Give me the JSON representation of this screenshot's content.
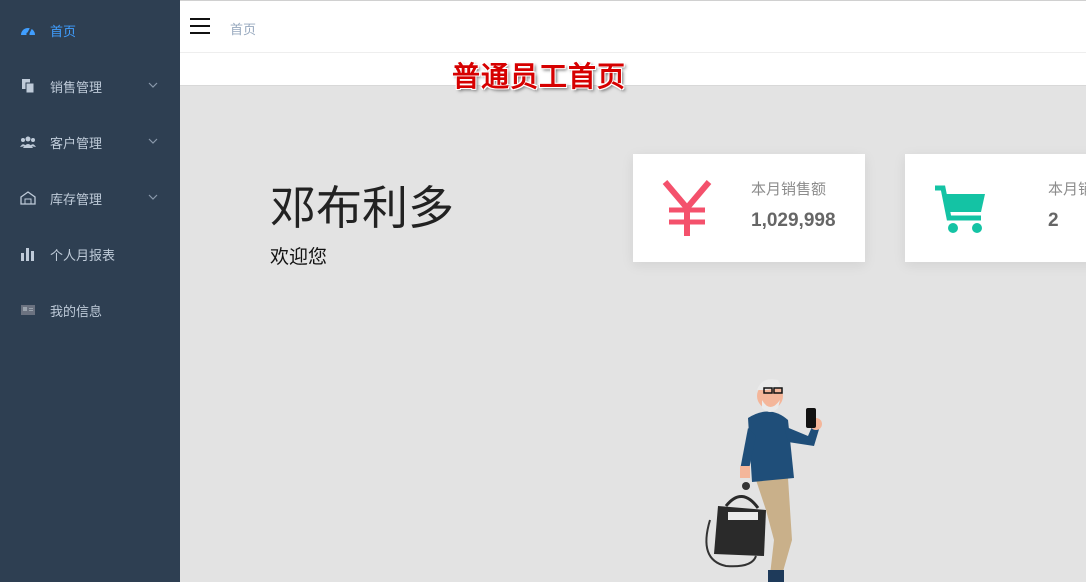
{
  "sidebar": {
    "items": [
      {
        "label": "首页",
        "icon": "dashboard-icon",
        "active": true
      },
      {
        "label": "销售管理",
        "icon": "documents-icon",
        "expandable": true
      },
      {
        "label": "客户管理",
        "icon": "customers-icon",
        "expandable": true
      },
      {
        "label": "库存管理",
        "icon": "warehouse-icon",
        "expandable": true
      },
      {
        "label": "个人月报表",
        "icon": "bar-chart-icon"
      },
      {
        "label": "我的信息",
        "icon": "id-card-icon"
      }
    ]
  },
  "header": {
    "breadcrumb": "首页"
  },
  "banner": {
    "title": "普通员工首页"
  },
  "main": {
    "user_name": "邓布利多",
    "welcome": "欢迎您"
  },
  "cards": [
    {
      "label": "本月销售额",
      "value": "1,029,998",
      "icon": "yen-icon",
      "color": "#f4516c"
    },
    {
      "label": "本月销",
      "value": "2",
      "icon": "shopping-cart-icon",
      "color": "#14c3a4"
    }
  ],
  "colors": {
    "sidebar_bg": "#2e3f52",
    "active": "#409eff",
    "banner_title": "#d60000"
  }
}
